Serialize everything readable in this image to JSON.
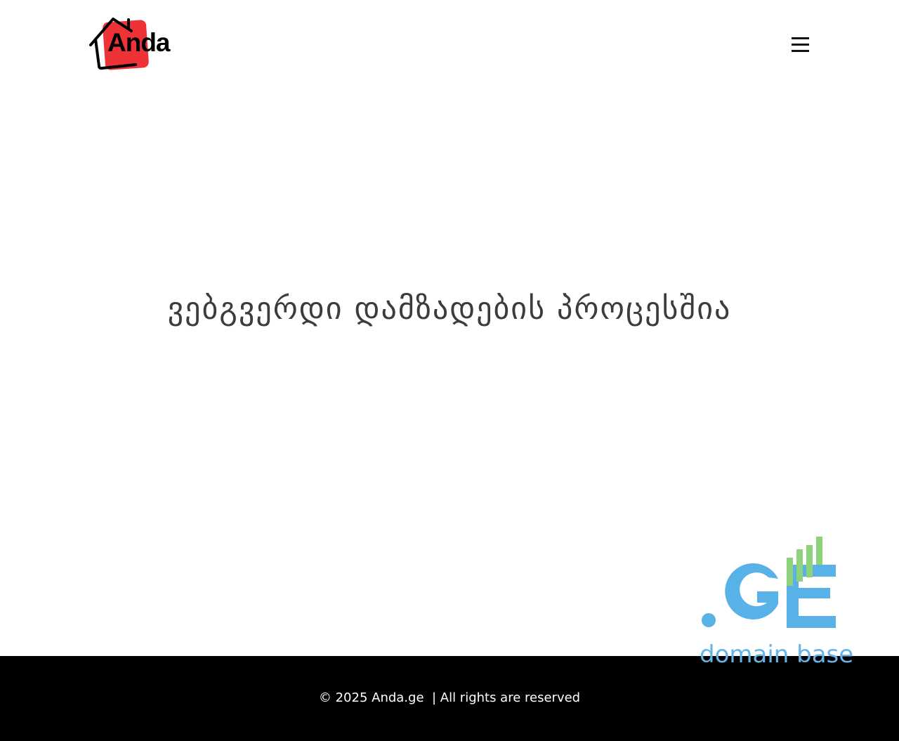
{
  "header": {
    "logo_text": "Anda",
    "logo_colors": {
      "accent": "#ee3338",
      "outline": "#000000"
    },
    "menu_icon": "hamburger-menu-icon"
  },
  "main": {
    "headline": "ვებგვერდი დამზადების პროცესშია"
  },
  "badge": {
    "mark": ".GE",
    "caption": "domain base",
    "colors": {
      "blue": "#58b1e7",
      "green": "#8ed27b"
    }
  },
  "footer": {
    "copyright": "© 2025 Anda.ge  | All rights are reserved"
  }
}
